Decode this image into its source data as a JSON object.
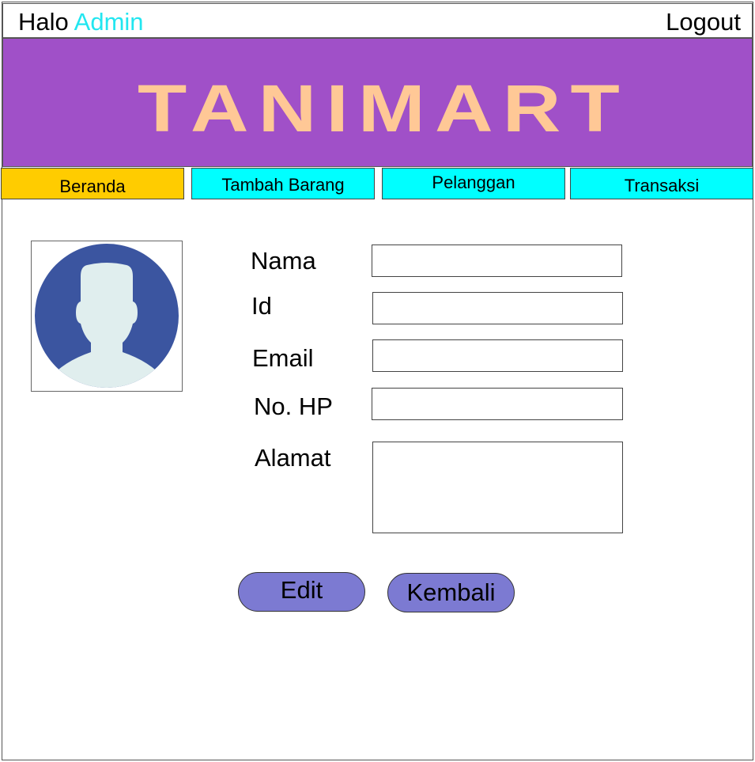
{
  "header": {
    "greeting": "Halo",
    "user": "Admin",
    "logout": "Logout"
  },
  "banner": {
    "logo_text": "TANIMART",
    "background": "#a050c8",
    "logo_color": "#ffc896"
  },
  "nav": [
    {
      "label": "Beranda",
      "color": "#ffcc00",
      "active": true
    },
    {
      "label": "Tambah Barang",
      "color": "#00ffff"
    },
    {
      "label": "Pelanggan",
      "color": "#00ffff"
    },
    {
      "label": "Transaksi",
      "color": "#00ffff"
    }
  ],
  "avatar": {
    "icon": "user-avatar-icon",
    "circle_color": "#3b55a0",
    "figure_color": "#e0eeee"
  },
  "form": {
    "labels": {
      "nama": "Nama",
      "id": "Id",
      "email": "Email",
      "hp": "No. HP",
      "alamat": "Alamat"
    },
    "values": {
      "nama": "",
      "id": "",
      "email": "",
      "hp": "",
      "alamat": ""
    }
  },
  "buttons": {
    "edit": "Edit",
    "back": "Kembali",
    "color": "#7c7ad2"
  }
}
